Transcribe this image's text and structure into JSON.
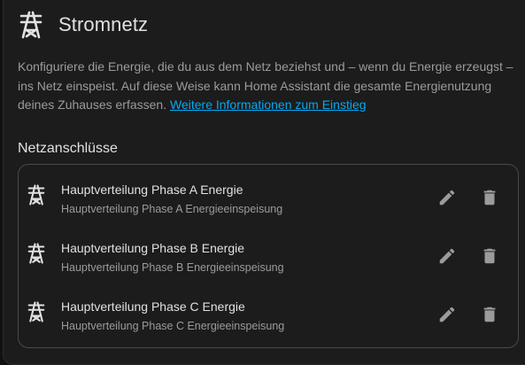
{
  "header": {
    "title": "Stromnetz",
    "icon": "transmission-tower-icon"
  },
  "description": {
    "text": "Konfiguriere die Energie, die du aus dem Netz beziehst und – wenn du Energie erzeugst – ins Netz einspeist. Auf diese Weise kann Home Assistant die gesamte Energienutzung deines Zuhauses erfassen. ",
    "link_text": "Weitere Informationen zum Einstieg"
  },
  "section": {
    "title": "Netzanschlüsse"
  },
  "connections": [
    {
      "title": "Hauptverteilung Phase A Energie",
      "subtitle": "Hauptverteilung Phase A Energieeinspeisung"
    },
    {
      "title": "Hauptverteilung Phase B Energie",
      "subtitle": "Hauptverteilung Phase B Energieeinspeisung"
    },
    {
      "title": "Hauptverteilung Phase C Energie",
      "subtitle": "Hauptverteilung Phase C Energieeinspeisung"
    }
  ],
  "colors": {
    "background": "#1c1c1c",
    "text_primary": "#e1e1e1",
    "text_secondary": "#9b9b9b",
    "link": "#03a9f4",
    "icon_action": "#9b9b9b"
  }
}
